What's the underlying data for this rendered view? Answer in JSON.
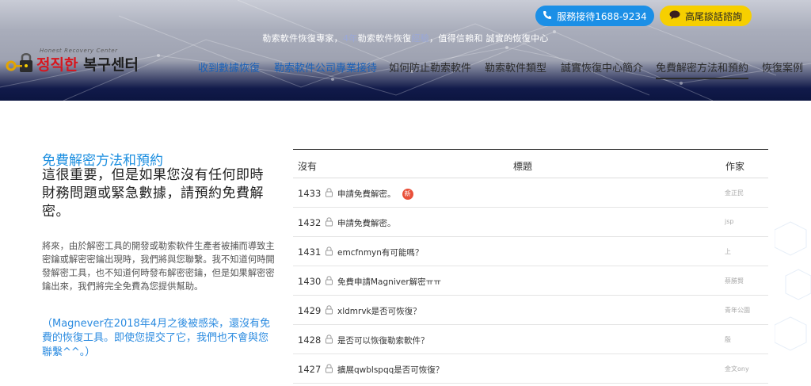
{
  "topbar": {
    "service_label": "服務接待1688-9234",
    "kakao_label": "高尾談話諮詢",
    "tagline_part1": "勒索軟件恢復專家，",
    "tagline_years": "4年",
    "tagline_part2": "勒索軟件恢復",
    "tagline_exp": "經驗",
    "tagline_part3": "，值得信賴和 誠實的恢復中心"
  },
  "logo": {
    "subtitle": "Honest Recovery Center",
    "name_red": "정직한",
    "name_dark": " 복구센터"
  },
  "nav": {
    "items": [
      {
        "label": "收到數據恢復"
      },
      {
        "label": "勒索軟件公司專業接待"
      },
      {
        "label": "如何防止勒索軟件"
      },
      {
        "label": "勒索軟件類型"
      },
      {
        "label": "誠實恢復中心簡介"
      },
      {
        "label": "免費解密方法和預約"
      },
      {
        "label": "恢復案例"
      }
    ]
  },
  "left": {
    "heading": "免費解密方法和預約",
    "lead": "這很重要，但是如果您沒有任何即時財務問題或緊急數據，請預約免費解密。",
    "body": "將來，由於解密工具的開發或勒索軟件生產者被捕而導致主密鑰或解密密鑰出現時，我們將與您聯繫。我不知道何時開發解密工具，也不知道何時發布解密密鑰，但是如果解密密鑰出來，我們將完全免費為您提供幫助。",
    "note": "（Magnever在2018年4月之後被感染，還沒有免費的恢復工具。即使您提交了它，我們也不會與您聯繫^^。）"
  },
  "table": {
    "headers": {
      "num": "沒有",
      "title": "標題",
      "author": "作家"
    },
    "rows": [
      {
        "num": "1433",
        "title": "申請免費解密。",
        "badge": "新",
        "author": "金正民"
      },
      {
        "num": "1432",
        "title": "申請免費解密。",
        "author": "jsp"
      },
      {
        "num": "1431",
        "title": "emcfnmyn有可能嗎？",
        "author": "上"
      },
      {
        "num": "1430",
        "title": "免費申請Magniver解密ㅠㅠ",
        "author": "蔡勝賢"
      },
      {
        "num": "1429",
        "title": "xldmrvk是否可恢復？",
        "author": "青年公園"
      },
      {
        "num": "1428",
        "title": "是否可以恢復勒索軟件？",
        "author": "殷"
      },
      {
        "num": "1427",
        "title": "擴展qwblspqq是否可恢復？",
        "author": "金文ony"
      }
    ]
  },
  "icons": {
    "phone": "phone-icon",
    "chat": "chat-bubble-icon",
    "lock": "lock-icon"
  },
  "colors": {
    "accent_blue": "#1b8fe6",
    "kakao_yellow": "#f6cf00",
    "logo_red": "#d7161e",
    "heading_blue": "#1d8fe0",
    "badge_red": "#e9503a"
  }
}
